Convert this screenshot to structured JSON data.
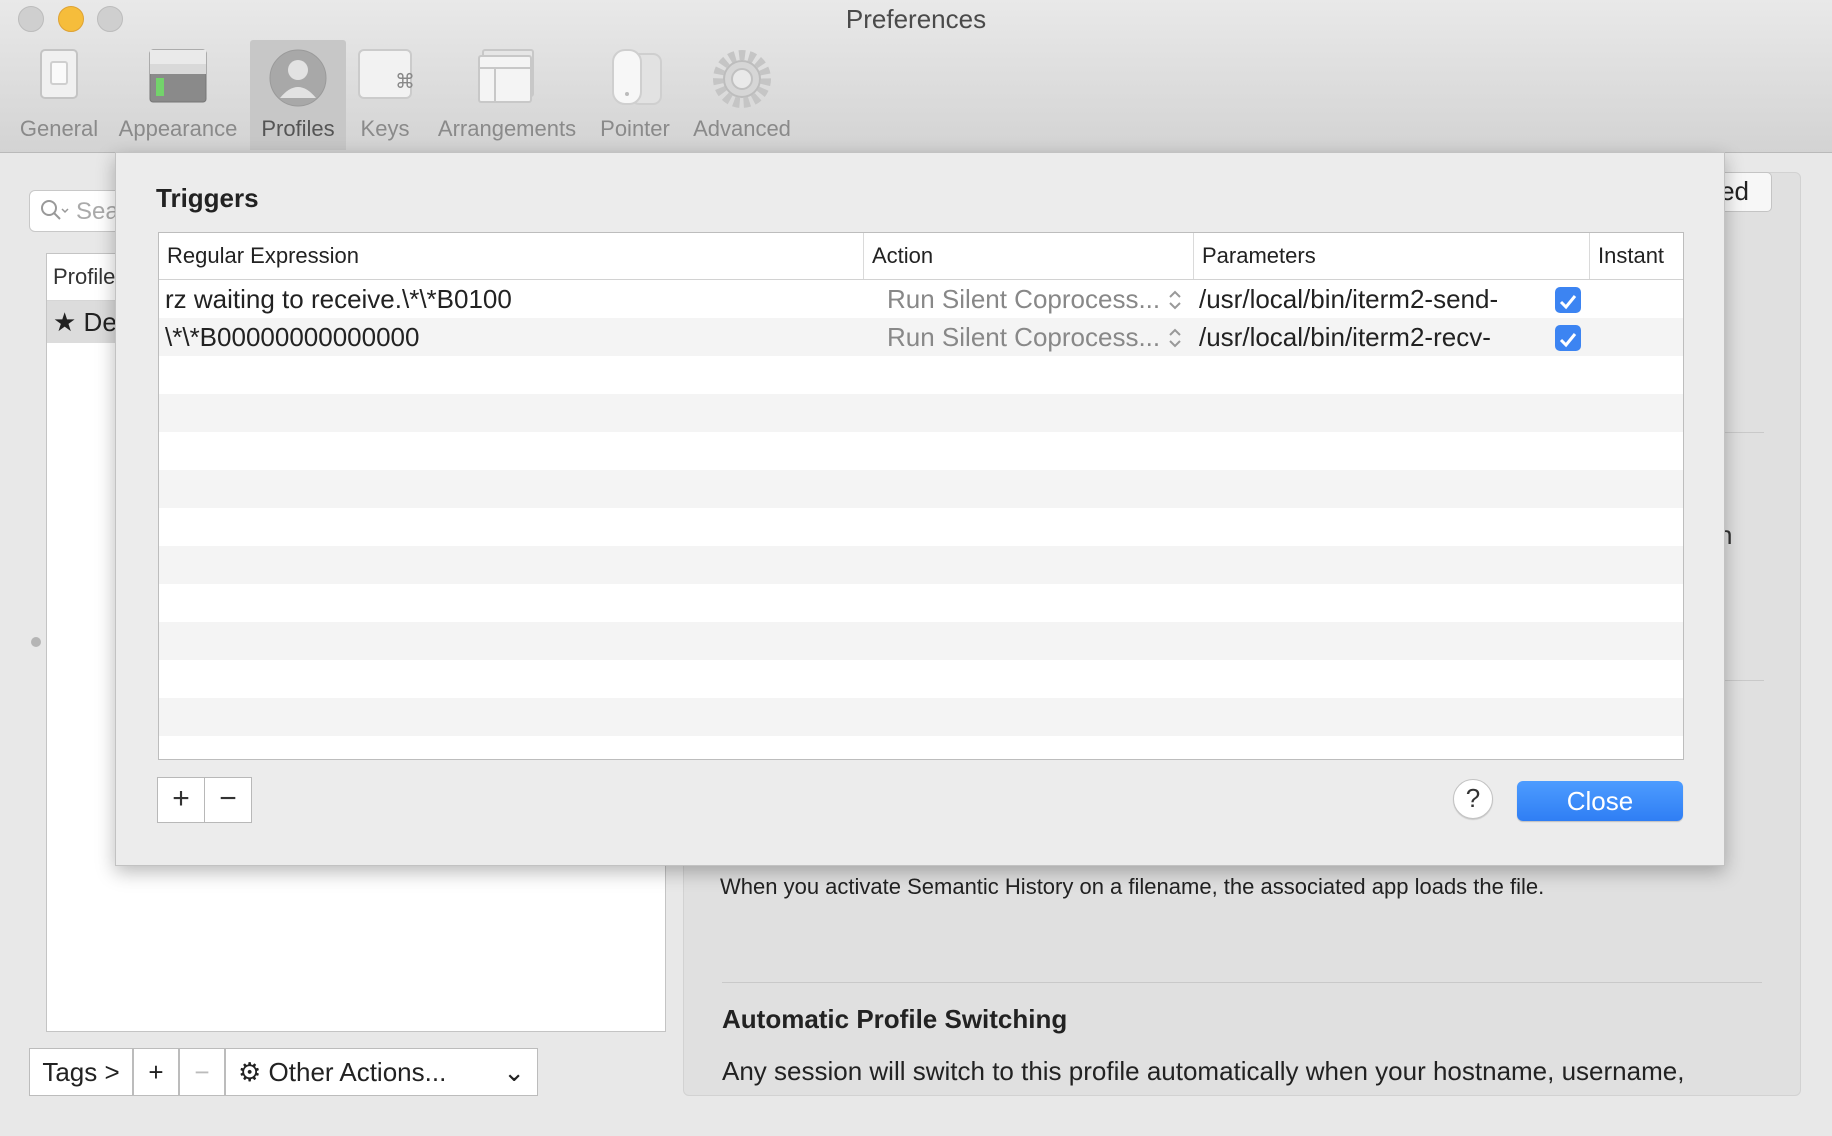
{
  "window": {
    "title": "Preferences"
  },
  "toolbar": {
    "items": [
      {
        "label": "General"
      },
      {
        "label": "Appearance"
      },
      {
        "label": "Profiles"
      },
      {
        "label": "Keys"
      },
      {
        "label": "Arrangements"
      },
      {
        "label": "Pointer"
      },
      {
        "label": "Advanced"
      }
    ],
    "active": "Profiles"
  },
  "profiles": {
    "search_placeholder": "Sea",
    "list_header": "Profile",
    "default_row": "De",
    "tags_label": "Tags >",
    "add_label": "+",
    "remove_label": "−",
    "other_actions_label": "Other Actions..."
  },
  "background": {
    "segment_partial": "ed",
    "partial_letter": "n",
    "semantic_history_text": "When you activate Semantic History on a filename, the associated app loads the file.",
    "aps_title": "Automatic Profile Switching",
    "aps_text": "Any session will switch to this profile automatically when your hostname, username,"
  },
  "triggers": {
    "title": "Triggers",
    "columns": {
      "regex": "Regular Expression",
      "action": "Action",
      "parameters": "Parameters",
      "instant": "Instant"
    },
    "rows": [
      {
        "regex": "rz waiting to receive.\\*\\*B0100",
        "action": "Run Silent Coprocess...",
        "parameters": "/usr/local/bin/iterm2-send-",
        "instant": true
      },
      {
        "regex": "\\*\\*B00000000000000",
        "action": "Run Silent Coprocess...",
        "parameters": "/usr/local/bin/iterm2-recv-",
        "instant": true
      }
    ],
    "add_label": "+",
    "remove_label": "−",
    "help_label": "?",
    "close_label": "Close"
  },
  "colors": {
    "accent": "#2f7ef4",
    "minimize": "#f6bd3b"
  }
}
